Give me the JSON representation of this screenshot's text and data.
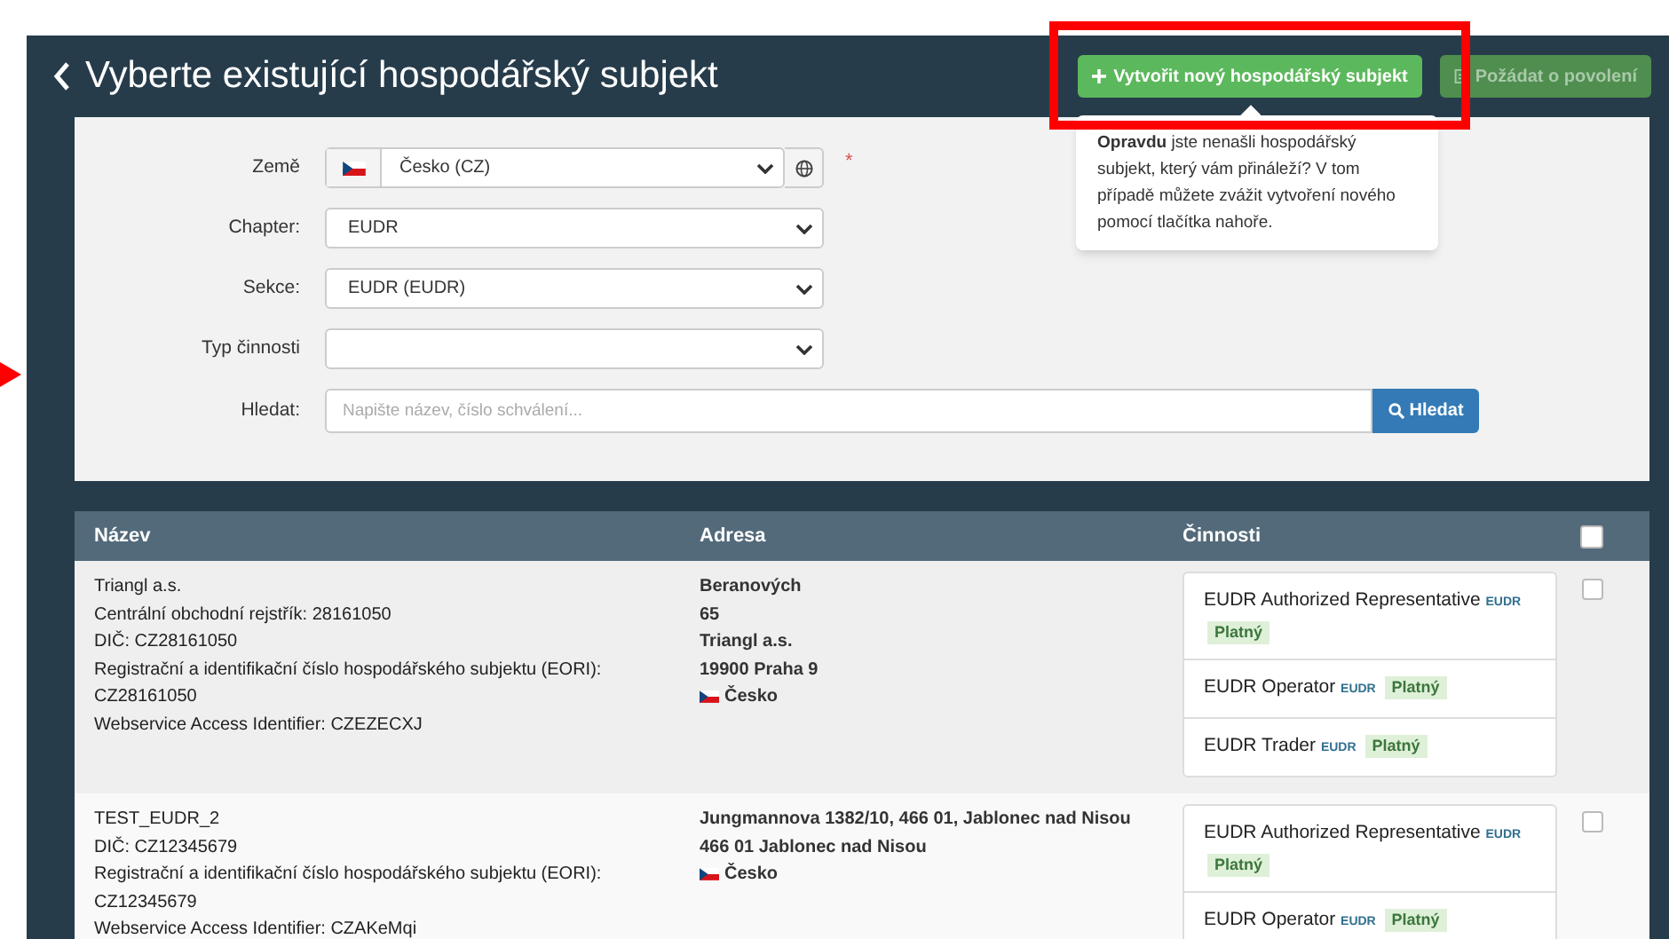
{
  "page": {
    "title": "Vyberte existující hospodářský subjekt"
  },
  "actions": [
    {
      "label": "Vytvořit nový hospodářský subjekt",
      "kind": "create",
      "disabled": false
    },
    {
      "label": "Požádat o povolení",
      "kind": "request",
      "disabled": true
    }
  ],
  "popover": {
    "text": "**Opravdu** jste nenašli hospodářský subjekt, který vám přináleží? V tom případě můžete zvážit vytvoření nového pomocí tlačítka nahoře."
  },
  "form": {
    "fields": [
      {
        "label": "Země",
        "kind": "country",
        "value": "Česko (CZ)",
        "required_mark": "*"
      },
      {
        "label": "Chapter:",
        "kind": "select",
        "value": "EUDR"
      },
      {
        "label": "Sekce:",
        "kind": "select",
        "value": "EUDR (EUDR)"
      },
      {
        "label": "Typ činnosti",
        "kind": "select"
      },
      {
        "label": "Hledat:",
        "kind": "search",
        "placeholder": "Napište název, číslo schválení...",
        "button": "Hledat"
      }
    ]
  },
  "table": {
    "columns": [
      "Název",
      "Adresa",
      "Činnosti"
    ],
    "select_all_checked": false,
    "rows": [
      {
        "name_lines": [
          "Triangl a.s.",
          "Centrální obchodní rejstřík: 28161050",
          "DIČ: CZ28161050",
          "Registrační a identifikační číslo hospodářského subjektu (EORI):",
          "CZ28161050",
          "Webservice Access Identifier: CZEZECXJ"
        ],
        "address_lines": [
          "Beranových",
          "65",
          "Triangl a.s.",
          "19900 Praha 9"
        ],
        "country": "Česko",
        "checked": false,
        "activities": [
          {
            "name": "EUDR Authorized Representative",
            "tag": "EUDR",
            "status": "Platný"
          },
          {
            "name": "EUDR Operator",
            "tag": "EUDR",
            "status": "Platný"
          },
          {
            "name": "EUDR Trader",
            "tag": "EUDR",
            "status": "Platný"
          }
        ]
      },
      {
        "name_lines": [
          "TEST_EUDR_2",
          "DIČ: CZ12345679",
          "Registrační a identifikační číslo hospodářského subjektu (EORI):",
          "CZ12345679",
          "Webservice Access Identifier: CZAKeMqi"
        ],
        "address_lines": [
          "Jungmannova 1382/10, 466 01, Jablonec nad Nisou",
          "466 01 Jablonec nad Nisou"
        ],
        "country": "Česko",
        "checked": false,
        "activities": [
          {
            "name": "EUDR Authorized Representative",
            "tag": "EUDR",
            "status": "Platný"
          },
          {
            "name": "EUDR Operator",
            "tag": "EUDR",
            "status": "Platný"
          }
        ]
      }
    ]
  }
}
